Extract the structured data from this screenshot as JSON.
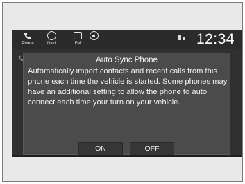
{
  "nav": {
    "phone_label": "Phone",
    "navi_label": "Navi",
    "fm_label": "FM"
  },
  "status": {
    "clock": "12:34"
  },
  "dialog": {
    "title": "Auto Sync Phone",
    "body": "Automatically import contacts and recent calls from this phone each time the vehicle is started. Some phones may have an additional setting to allow the phone to auto connect each time your turn on your vehicle.",
    "on_label": "ON",
    "off_label": "OFF"
  },
  "icons": {
    "phone": "phone-icon",
    "navi": "navigation-icon",
    "fm": "radio-icon",
    "audio": "audio-source-icon",
    "bluetooth": "bluetooth-icon",
    "signal": "signal-icon"
  },
  "colors": {
    "screen_bg": "#303030",
    "dialog_bg": "#4b4b4b",
    "button_bg": "#373737",
    "text": "#f2f2f2"
  }
}
